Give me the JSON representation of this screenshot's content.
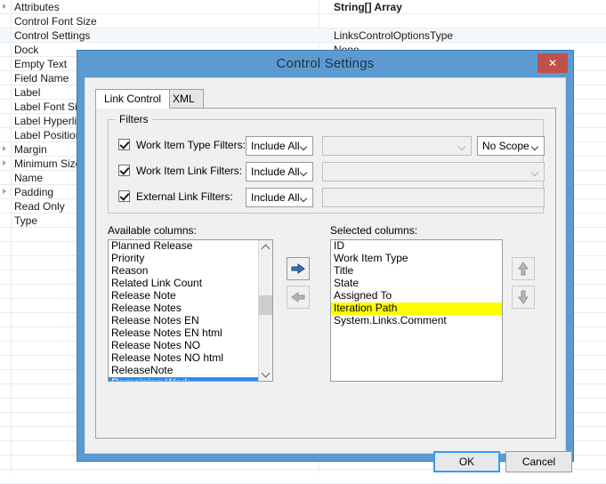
{
  "background": {
    "properties": [
      {
        "name": "Attributes",
        "expandable": true,
        "value": "String[] Array",
        "bold": true,
        "alt": false
      },
      {
        "name": "Control Font Size",
        "expandable": false,
        "value": "",
        "bold": false,
        "alt": false
      },
      {
        "name": "Control Settings",
        "expandable": false,
        "value": "LinksControlOptionsType",
        "bold": false,
        "alt": true
      },
      {
        "name": "Dock",
        "expandable": false,
        "value": "None",
        "bold": false,
        "alt": false
      },
      {
        "name": "Empty Text",
        "expandable": false,
        "value": "",
        "bold": false,
        "alt": false
      },
      {
        "name": "Field Name",
        "expandable": false,
        "value": "",
        "bold": false,
        "alt": false
      },
      {
        "name": "Label",
        "expandable": false,
        "value": "",
        "bold": false,
        "alt": false
      },
      {
        "name": "Label Font Size",
        "expandable": false,
        "value": "",
        "bold": false,
        "alt": false
      },
      {
        "name": "Label Hyperlink",
        "expandable": false,
        "value": "",
        "bold": false,
        "alt": false
      },
      {
        "name": "Label Position",
        "expandable": false,
        "value": "",
        "bold": false,
        "alt": false
      },
      {
        "name": "Margin",
        "expandable": true,
        "value": "",
        "bold": false,
        "alt": false
      },
      {
        "name": "Minimum Size",
        "expandable": true,
        "value": "",
        "bold": false,
        "alt": false
      },
      {
        "name": "Name",
        "expandable": false,
        "value": "",
        "bold": false,
        "alt": false
      },
      {
        "name": "Padding",
        "expandable": true,
        "value": "",
        "bold": false,
        "alt": false
      },
      {
        "name": "Read Only",
        "expandable": false,
        "value": "",
        "bold": false,
        "alt": false
      },
      {
        "name": "Type",
        "expandable": false,
        "value": "",
        "bold": false,
        "alt": false
      }
    ]
  },
  "dialog": {
    "title": "Control Settings",
    "close_label": "✕",
    "tabs": [
      {
        "label": "Link Control",
        "active": true
      },
      {
        "label": "XML",
        "active": false
      }
    ],
    "filters": {
      "legend": "Filters",
      "rows": [
        {
          "label": "Work Item Type Filters:",
          "checked": true,
          "mode": "Include All",
          "list_value": "",
          "scope": "No Scope"
        },
        {
          "label": "Work Item Link Filters:",
          "checked": true,
          "mode": "Include All",
          "list_value": ""
        },
        {
          "label": "External Link Filters:",
          "checked": true,
          "mode": "Include All",
          "list_value": ""
        }
      ]
    },
    "columns": {
      "available_label": "Available columns:",
      "selected_label": "Selected columns:",
      "available_items": [
        {
          "text": "Planned Release",
          "state": "normal"
        },
        {
          "text": "Priority",
          "state": "normal"
        },
        {
          "text": "Reason",
          "state": "normal"
        },
        {
          "text": "Related Link Count",
          "state": "normal"
        },
        {
          "text": "Release Note",
          "state": "normal"
        },
        {
          "text": "Release Notes",
          "state": "normal"
        },
        {
          "text": "Release Notes EN",
          "state": "normal"
        },
        {
          "text": "Release Notes EN html",
          "state": "normal"
        },
        {
          "text": "Release Notes NO",
          "state": "normal"
        },
        {
          "text": "Release Notes NO html",
          "state": "normal"
        },
        {
          "text": "ReleaseNote",
          "state": "normal"
        },
        {
          "text": "Remaining Work",
          "state": "selected"
        }
      ],
      "selected_items": [
        {
          "text": "ID",
          "state": "normal"
        },
        {
          "text": "Work Item Type",
          "state": "normal"
        },
        {
          "text": "Title",
          "state": "normal"
        },
        {
          "text": "State",
          "state": "normal"
        },
        {
          "text": "Assigned To",
          "state": "normal"
        },
        {
          "text": "Iteration Path",
          "state": "highlighted"
        },
        {
          "text": "System.Links.Comment",
          "state": "normal"
        }
      ]
    },
    "buttons": {
      "add": "add-column",
      "remove": "remove-column",
      "move_up": "move-up",
      "move_down": "move-down",
      "ok": "OK",
      "cancel": "Cancel"
    }
  },
  "colors": {
    "window_frame": "#5b9bd1",
    "close_button": "#c0504d",
    "selection": "#2b8cf0",
    "highlight": "#ffff00",
    "focus_border": "#3399ff"
  }
}
